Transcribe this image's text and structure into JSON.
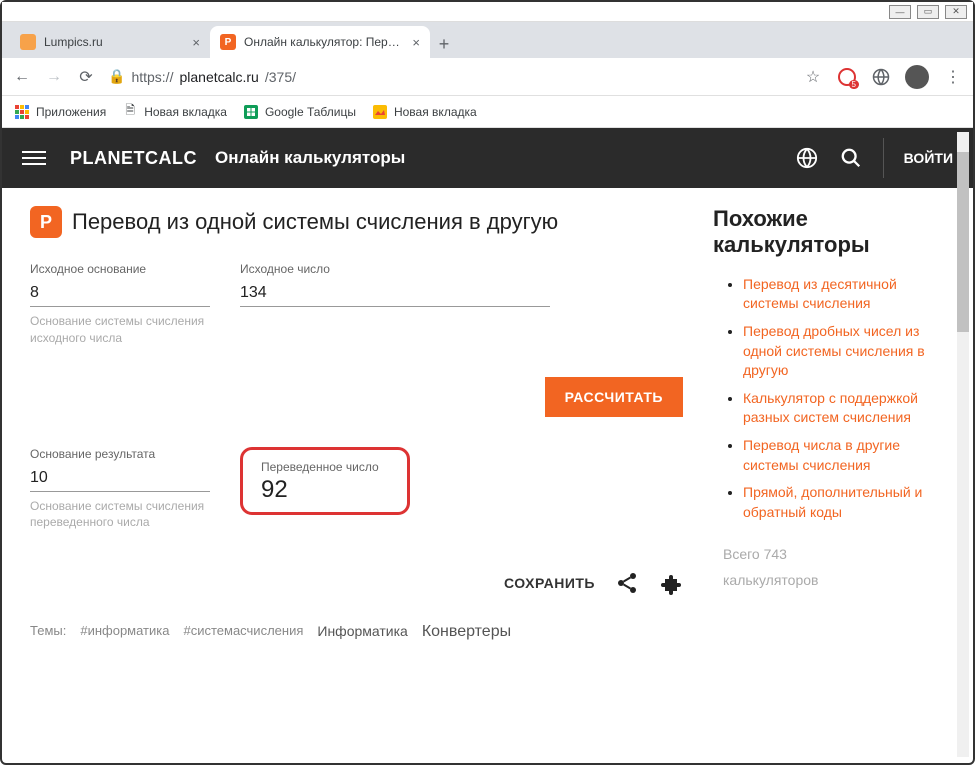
{
  "window": {
    "tabs": [
      {
        "title": "Lumpics.ru",
        "favicon_bg": "#f7a24a"
      },
      {
        "title": "Онлайн калькулятор: Перевод",
        "favicon_bg": "#f26522",
        "favicon_text": "P"
      }
    ],
    "url_prefix": "https://",
    "url_domain": "planetcalc.ru",
    "url_path": "/375/",
    "badge_count": "5"
  },
  "bookmarks": [
    {
      "label": "Приложения",
      "icon": "apps"
    },
    {
      "label": "Новая вкладка",
      "icon": "doc"
    },
    {
      "label": "Google Таблицы",
      "icon": "sheets"
    },
    {
      "label": "Новая вкладка",
      "icon": "img"
    }
  ],
  "header": {
    "brand": "PLANETCALC",
    "subtitle": "Онлайн калькуляторы",
    "login": "ВОЙТИ"
  },
  "page": {
    "icon_text": "P",
    "title": "Перевод из одной системы счисления в другую",
    "source_base": {
      "label": "Исходное основание",
      "value": "8",
      "help": "Основание системы счисления исходного числа"
    },
    "source_number": {
      "label": "Исходное число",
      "value": "134"
    },
    "result_base": {
      "label": "Основание результата",
      "value": "10",
      "help": "Основание системы счисления переведенного числа"
    },
    "result": {
      "label": "Переведенное число",
      "value": "92"
    },
    "calculate": "РАССЧИТАТЬ",
    "save": "СОХРАНИТЬ"
  },
  "tags": {
    "label": "Темы:",
    "items": [
      "#информатика",
      "#системасчисления"
    ],
    "categories": [
      "Информатика",
      "Конвертеры"
    ]
  },
  "sidebar": {
    "heading": "Похожие калькуляторы",
    "links": [
      "Перевод из десятичной системы счисления",
      "Перевод дробных чисел из одной системы счисления в другую",
      "Калькулятор с поддержкой разных систем счисления",
      "Перевод числа в другие системы счисления",
      "Прямой, дополнительный и обратный коды"
    ],
    "total_prefix": "Всего ",
    "total_count": "743",
    "total_suffix": "калькуляторов"
  }
}
